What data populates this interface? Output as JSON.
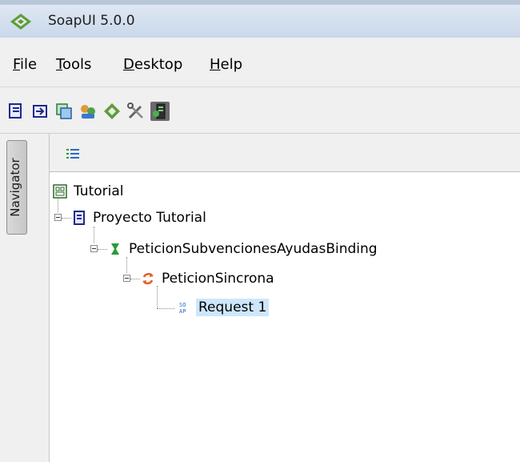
{
  "window": {
    "title": "SoapUI 5.0.0"
  },
  "menu": [
    {
      "mnemonic": "F",
      "rest": "ile"
    },
    {
      "mnemonic": "T",
      "rest": "ools"
    },
    {
      "mnemonic": "D",
      "rest": "esktop"
    },
    {
      "mnemonic": "H",
      "rest": "elp"
    }
  ],
  "toolbar": {
    "buttons": [
      "new-project-icon",
      "import-project-icon",
      "save-all-icon",
      "forum-icon",
      "soapui-online-icon",
      "preferences-icon",
      "proxy-icon"
    ],
    "active_index": 6
  },
  "navigator": {
    "tab_label": "Navigator"
  },
  "tree": [
    {
      "label": "Tutorial",
      "icon": "workspace-icon"
    },
    {
      "label": "Proyecto Tutorial",
      "icon": "project-icon"
    },
    {
      "label": "PeticionSubvencionesAyudasBinding",
      "icon": "interface-icon"
    },
    {
      "label": "PeticionSincrona",
      "icon": "operation-icon"
    },
    {
      "label": "Request 1",
      "icon": "soap-request-icon",
      "selected": true
    }
  ],
  "colors": {
    "selection": "#cde6fb",
    "title_bar": "#c9d8ea",
    "chrome": "#f0f0f0"
  }
}
